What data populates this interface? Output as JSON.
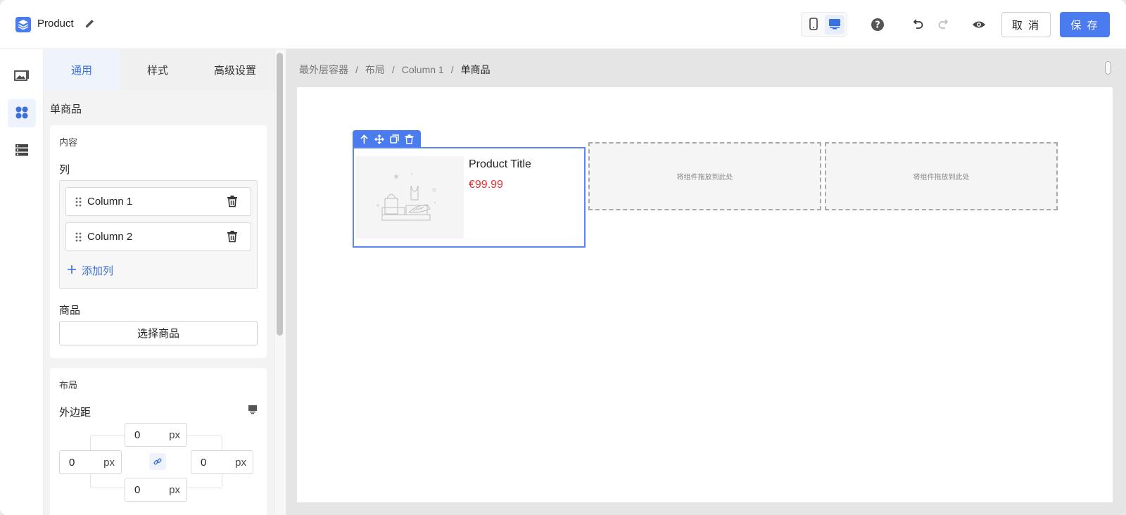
{
  "header": {
    "app_title": "Product",
    "cancel_label": "取 消",
    "save_label": "保 存",
    "icons": [
      "layers-icon",
      "edit-icon",
      "mobile-icon",
      "desktop-icon",
      "help-icon",
      "undo-icon",
      "redo-icon",
      "preview-icon"
    ]
  },
  "rail": {
    "items": [
      {
        "icon": "media-icon",
        "active": false
      },
      {
        "icon": "components-icon",
        "active": true
      },
      {
        "icon": "layers-list-icon",
        "active": false
      }
    ]
  },
  "panel": {
    "tabs": [
      {
        "label": "通用",
        "active": true
      },
      {
        "label": "样式",
        "active": false
      },
      {
        "label": "高级设置",
        "active": false
      }
    ],
    "section_title": "单商品",
    "content_card": {
      "title": "内容",
      "columns_label": "列",
      "columns": [
        {
          "label": "Column 1"
        },
        {
          "label": "Column 2"
        }
      ],
      "add_column_label": "添加列",
      "product_label": "商品",
      "select_product_label": "选择商品"
    },
    "layout_card": {
      "title": "布局",
      "margin_label": "外边距",
      "margin": {
        "top": {
          "value": "0",
          "unit": "px"
        },
        "left": {
          "value": "0",
          "unit": "px"
        },
        "right": {
          "value": "0",
          "unit": "px"
        },
        "bottom": {
          "value": "0",
          "unit": "px"
        }
      }
    }
  },
  "canvas": {
    "breadcrumb": [
      "最外层容器",
      "布局",
      "Column 1",
      "单商品"
    ],
    "product": {
      "title": "Product Title",
      "price": "€99.99"
    },
    "drop_zone_text": "将组件拖放到此处",
    "colors": {
      "accent": "#4a7cf0",
      "price": "#e53030",
      "selection_border": "#5b86ef"
    }
  }
}
